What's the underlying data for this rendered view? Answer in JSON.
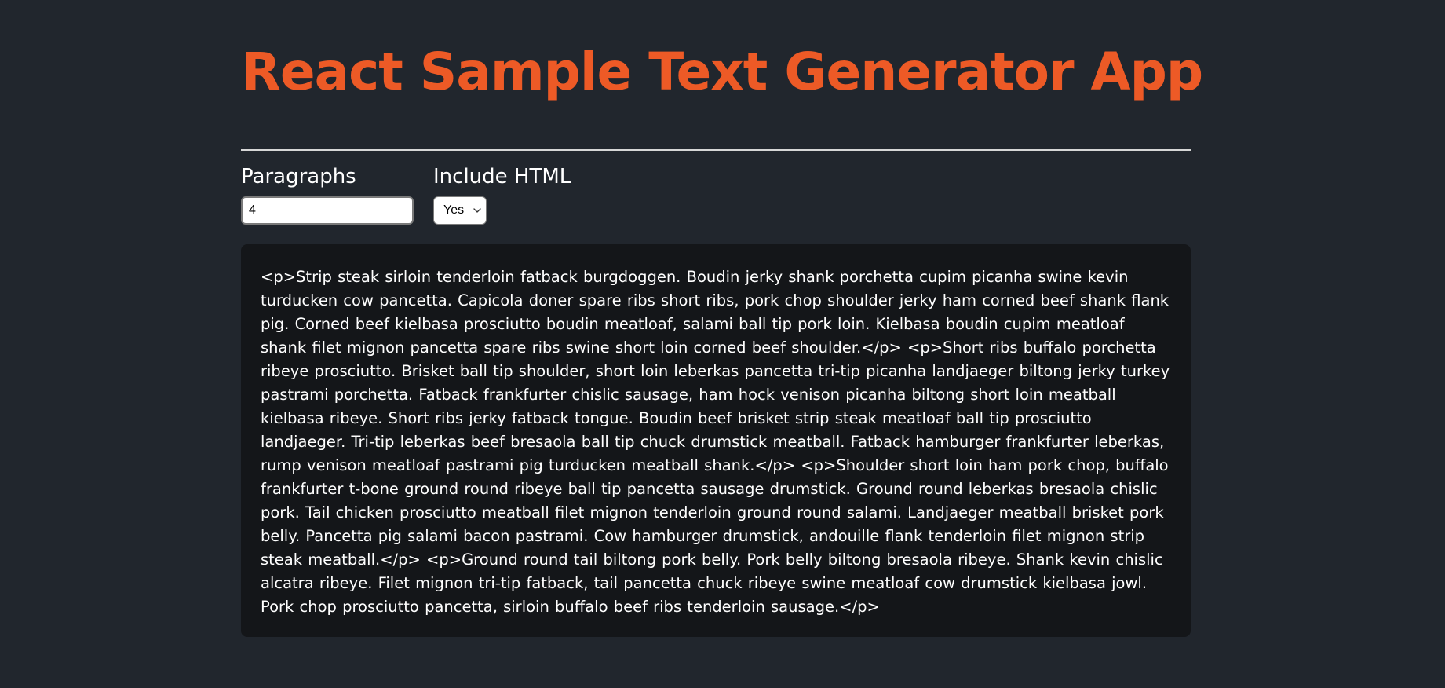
{
  "app": {
    "title": "React Sample Text Generator App"
  },
  "form": {
    "paragraphs": {
      "label": "Paragraphs",
      "value": "4"
    },
    "include_html": {
      "label": "Include HTML",
      "selected": "Yes"
    }
  },
  "output": {
    "text": "<p>Strip steak sirloin tenderloin fatback burgdoggen. Boudin jerky shank porchetta cupim picanha swine kevin turducken cow pancetta. Capicola doner spare ribs short ribs, pork chop shoulder jerky ham corned beef shank flank pig. Corned beef kielbasa prosciutto boudin meatloaf, salami ball tip pork loin. Kielbasa boudin cupim meatloaf shank filet mignon pancetta spare ribs swine short loin corned beef shoulder.</p> <p>Short ribs buffalo porchetta ribeye prosciutto. Brisket ball tip shoulder, short loin leberkas pancetta tri-tip picanha landjaeger biltong jerky turkey pastrami porchetta. Fatback frankfurter chislic sausage, ham hock venison picanha biltong short loin meatball kielbasa ribeye. Short ribs jerky fatback tongue. Boudin beef brisket strip steak meatloaf ball tip prosciutto landjaeger. Tri-tip leberkas beef bresaola ball tip chuck drumstick meatball. Fatback hamburger frankfurter leberkas, rump venison meatloaf pastrami pig turducken meatball shank.</p> <p>Shoulder short loin ham pork chop, buffalo frankfurter t-bone ground round ribeye ball tip pancetta sausage drumstick. Ground round leberkas bresaola chislic pork. Tail chicken prosciutto meatball filet mignon tenderloin ground round salami. Landjaeger meatball brisket pork belly. Pancetta pig salami bacon pastrami. Cow hamburger drumstick, andouille flank tenderloin filet mignon strip steak meatball.</p> <p>Ground round tail biltong pork belly. Pork belly biltong bresaola ribeye. Shank kevin chislic alcatra ribeye. Filet mignon tri-tip fatback, tail pancetta chuck ribeye swine meatloaf cow drumstick kielbasa jowl. Pork chop prosciutto pancetta, sirloin buffalo beef ribs tenderloin sausage.</p>"
  },
  "icons": {
    "select_arrow": "chevron-down-icon"
  },
  "colors": {
    "background": "#21262d",
    "accent": "#ed5a26",
    "output_background": "#141619",
    "text": "#ffffff"
  }
}
